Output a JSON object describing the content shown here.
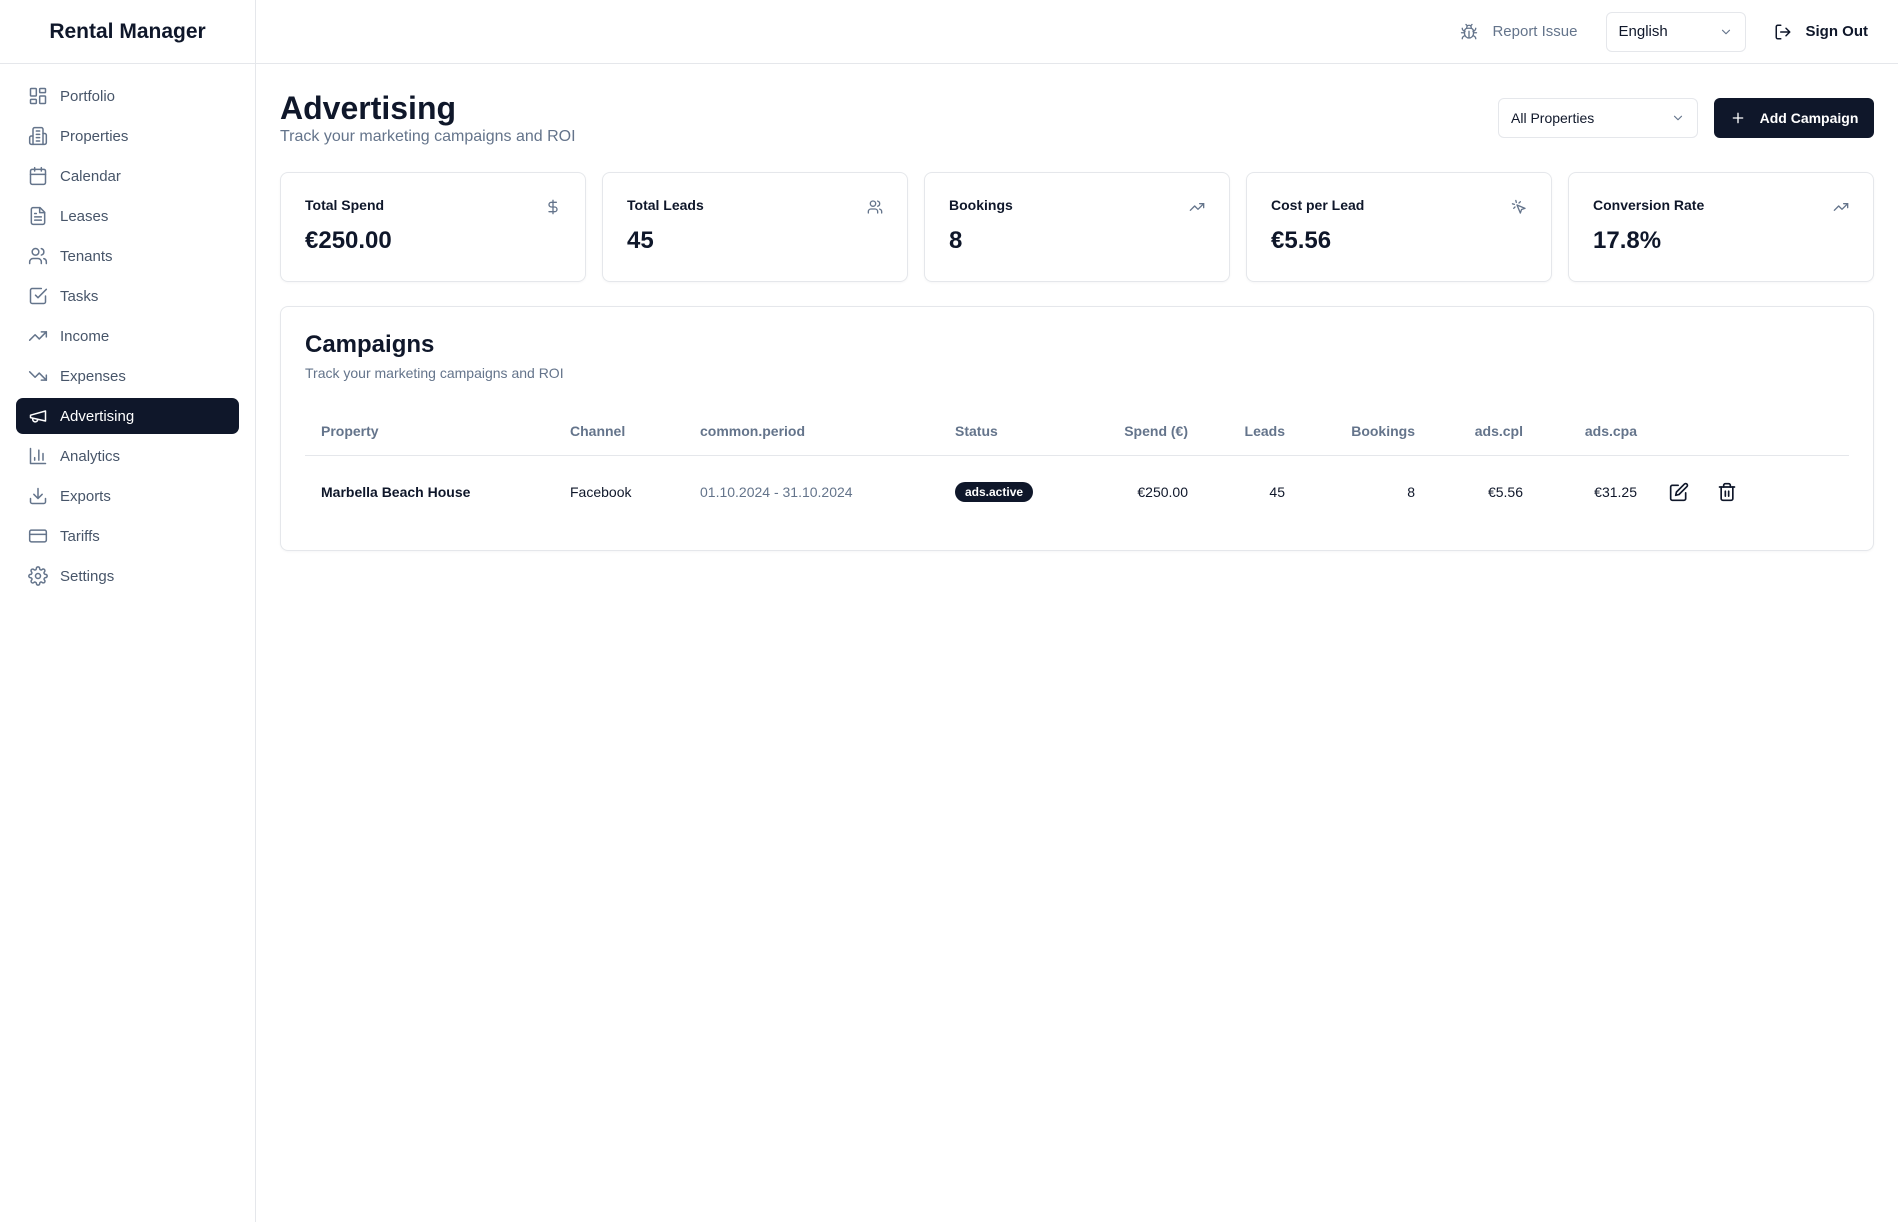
{
  "app": {
    "name": "Rental Manager"
  },
  "sidebar": {
    "items": [
      {
        "label": "Portfolio",
        "icon": "grid-icon",
        "active": false
      },
      {
        "label": "Properties",
        "icon": "building-icon",
        "active": false
      },
      {
        "label": "Calendar",
        "icon": "calendar-icon",
        "active": false
      },
      {
        "label": "Leases",
        "icon": "document-icon",
        "active": false
      },
      {
        "label": "Tenants",
        "icon": "users-icon",
        "active": false
      },
      {
        "label": "Tasks",
        "icon": "checkbox-icon",
        "active": false
      },
      {
        "label": "Income",
        "icon": "trending-up-icon",
        "active": false
      },
      {
        "label": "Expenses",
        "icon": "trending-down-icon",
        "active": false
      },
      {
        "label": "Advertising",
        "icon": "megaphone-icon",
        "active": true
      },
      {
        "label": "Analytics",
        "icon": "bar-chart-icon",
        "active": false
      },
      {
        "label": "Exports",
        "icon": "download-icon",
        "active": false
      },
      {
        "label": "Tariffs",
        "icon": "credit-card-icon",
        "active": false
      },
      {
        "label": "Settings",
        "icon": "gear-icon",
        "active": false
      }
    ]
  },
  "topbar": {
    "report_label": "Report Issue",
    "language": "English",
    "signout_label": "Sign Out"
  },
  "page": {
    "title": "Advertising",
    "subtitle": "Track your marketing campaigns and ROI",
    "property_filter": "All Properties",
    "add_label": "Add Campaign"
  },
  "stats": [
    {
      "label": "Total Spend",
      "value": "€250.00",
      "icon": "dollar-icon"
    },
    {
      "label": "Total Leads",
      "value": "45",
      "icon": "users-icon"
    },
    {
      "label": "Bookings",
      "value": "8",
      "icon": "trending-up-icon"
    },
    {
      "label": "Cost per Lead",
      "value": "€5.56",
      "icon": "cursor-click-icon"
    },
    {
      "label": "Conversion Rate",
      "value": "17.8%",
      "icon": "trending-up-icon"
    }
  ],
  "campaigns": {
    "title": "Campaigns",
    "subtitle": "Track your marketing campaigns and ROI",
    "columns": {
      "property": "Property",
      "channel": "Channel",
      "period": "common.period",
      "status": "Status",
      "spend": "Spend (€)",
      "leads": "Leads",
      "bookings": "Bookings",
      "cpl": "ads.cpl",
      "cpa": "ads.cpa"
    },
    "rows": [
      {
        "property": "Marbella Beach House",
        "channel": "Facebook",
        "period": "01.10.2024 - 31.10.2024",
        "status": "ads.active",
        "spend": "€250.00",
        "leads": "45",
        "bookings": "8",
        "cpl": "€5.56",
        "cpa": "€31.25"
      }
    ]
  },
  "colors": {
    "primary": "#0f172a",
    "muted": "#64748b",
    "border": "#e5e7eb"
  }
}
